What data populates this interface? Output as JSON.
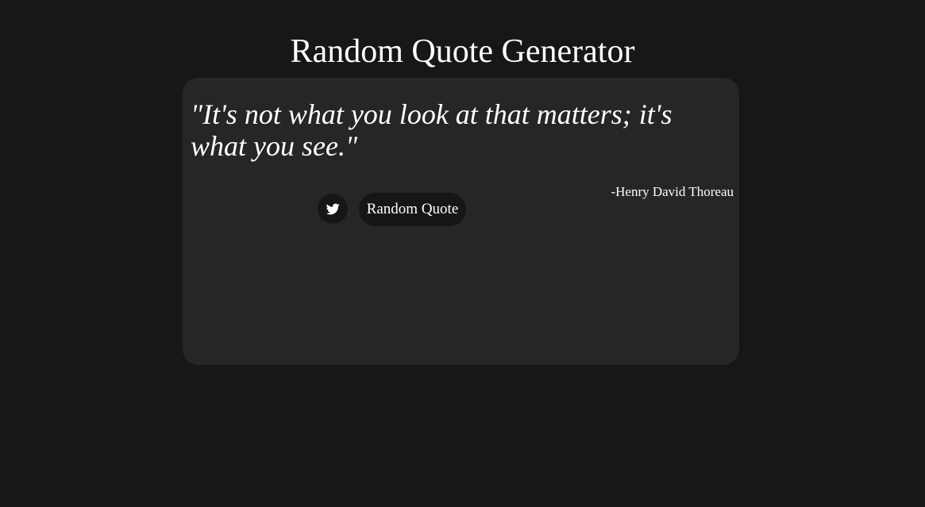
{
  "page": {
    "title": "Random Quote Generator"
  },
  "quote": {
    "text": "\"It's not what you look at that matters; it's what you see.\"",
    "author": "-Henry David Thoreau"
  },
  "actions": {
    "tweet_icon": "twitter-bird-icon",
    "random_label": "Random Quote"
  },
  "colors": {
    "background": "#171717",
    "card": "#262626",
    "button": "#161616",
    "text": "#ffffff"
  }
}
